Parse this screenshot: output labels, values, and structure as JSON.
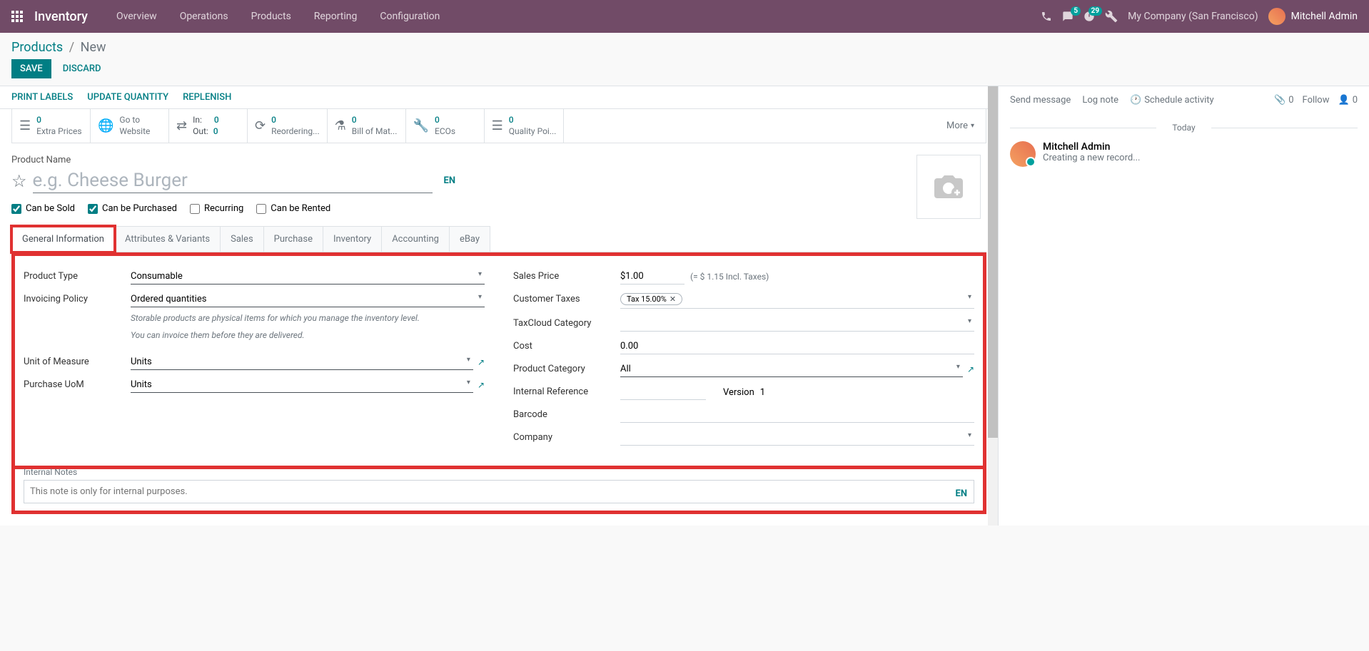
{
  "nav": {
    "brand": "Inventory",
    "menu": [
      "Overview",
      "Operations",
      "Products",
      "Reporting",
      "Configuration"
    ],
    "msg_badge": "5",
    "activity_badge": "29",
    "company": "My Company (San Francisco)",
    "user": "Mitchell Admin"
  },
  "breadcrumb": {
    "parent": "Products",
    "current": "New"
  },
  "actions": {
    "save": "SAVE",
    "discard": "DISCARD"
  },
  "toolbar": [
    "PRINT LABELS",
    "UPDATE QUANTITY",
    "REPLENISH"
  ],
  "stats": [
    {
      "val": "0",
      "label": "Extra Prices"
    },
    {
      "val": "",
      "label1": "Go to",
      "label2": "Website"
    },
    {
      "label1": "In:",
      "val1": "0",
      "label2": "Out:",
      "val2": "0"
    },
    {
      "val": "0",
      "label": "Reordering..."
    },
    {
      "val": "0",
      "label": "Bill of Mat..."
    },
    {
      "val": "0",
      "label": "ECOs"
    },
    {
      "val": "0",
      "label": "Quality Poi..."
    }
  ],
  "more": "More",
  "product": {
    "name_label": "Product Name",
    "placeholder": "e.g. Cheese Burger",
    "lang": "EN"
  },
  "checks": {
    "sold": "Can be Sold",
    "purchased": "Can be Purchased",
    "recurring": "Recurring",
    "rented": "Can be Rented"
  },
  "tabs": [
    "General Information",
    "Attributes & Variants",
    "Sales",
    "Purchase",
    "Inventory",
    "Accounting",
    "eBay"
  ],
  "fields_left": {
    "product_type": {
      "label": "Product Type",
      "value": "Consumable"
    },
    "invoicing": {
      "label": "Invoicing Policy",
      "value": "Ordered quantities"
    },
    "help1": "Storable products are physical items for which you manage the inventory level.",
    "help2": "You can invoice them before they are delivered.",
    "uom": {
      "label": "Unit of Measure",
      "value": "Units"
    },
    "purchase_uom": {
      "label": "Purchase UoM",
      "value": "Units"
    }
  },
  "fields_right": {
    "sales_price": {
      "label": "Sales Price",
      "value": "$1.00",
      "note": "(= $ 1.15 Incl. Taxes)"
    },
    "customer_taxes": {
      "label": "Customer Taxes",
      "tag": "Tax 15.00%"
    },
    "taxcloud": {
      "label": "TaxCloud Category"
    },
    "cost": {
      "label": "Cost",
      "value": "0.00"
    },
    "category": {
      "label": "Product Category",
      "value": "All"
    },
    "internal_ref": {
      "label": "Internal Reference",
      "version_label": "Version",
      "version_value": "1"
    },
    "barcode": {
      "label": "Barcode"
    },
    "company": {
      "label": "Company"
    }
  },
  "notes": {
    "label": "Internal Notes",
    "placeholder": "This note is only for internal purposes.",
    "lang": "EN"
  },
  "chatter": {
    "send": "Send message",
    "log": "Log note",
    "schedule": "Schedule activity",
    "attach_count": "0",
    "follow": "Follow",
    "follower_count": "0",
    "today": "Today",
    "author": "Mitchell Admin",
    "msg": "Creating a new record..."
  }
}
